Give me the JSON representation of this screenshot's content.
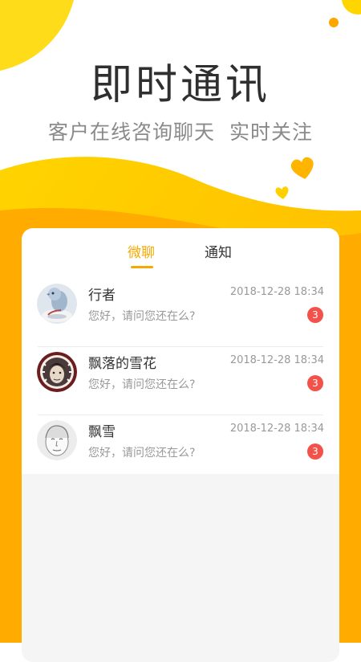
{
  "hero": {
    "title": "即时通讯",
    "subtitle": "客户在线咨询聊天  实时关注"
  },
  "colors": {
    "accent": "#f5a800",
    "badge": "#f3524a",
    "wave_yellow": "#ffd200",
    "wave_orange": "#ffb000"
  },
  "tabs": [
    {
      "label": "微聊",
      "active": true
    },
    {
      "label": "通知",
      "active": false
    }
  ],
  "conversations": [
    {
      "name": "行者",
      "time": "2018-12-28 18:34",
      "preview": "您好，请问您还在么?",
      "unread": "3",
      "avatar": "bird-avatar"
    },
    {
      "name": "飘落的雪花",
      "time": "2018-12-28 18:34",
      "preview": "您好，请问您还在么?",
      "unread": "3",
      "avatar": "man-portrait-avatar"
    },
    {
      "name": "飘雪",
      "time": "2018-12-28 18:34",
      "preview": "您好，请问您还在么?",
      "unread": "3",
      "avatar": "sketch-face-avatar"
    }
  ]
}
